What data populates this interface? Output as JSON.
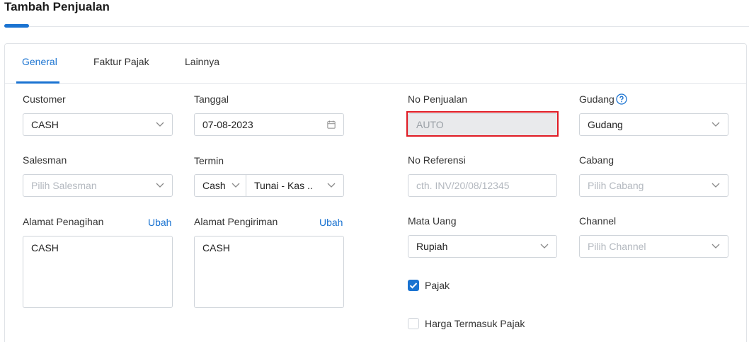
{
  "page": {
    "title": "Tambah Penjualan"
  },
  "tabs": [
    {
      "label": "General",
      "active": true
    },
    {
      "label": "Faktur Pajak",
      "active": false
    },
    {
      "label": "Lainnya",
      "active": false
    }
  ],
  "form": {
    "customer": {
      "label": "Customer",
      "value": "CASH"
    },
    "tanggal": {
      "label": "Tanggal",
      "value": "07-08-2023"
    },
    "no_penjualan": {
      "label": "No Penjualan",
      "value": "AUTO"
    },
    "gudang": {
      "label": "Gudang",
      "value": "Gudang"
    },
    "salesman": {
      "label": "Salesman",
      "placeholder": "Pilih Salesman"
    },
    "termin": {
      "label": "Termin",
      "type_value": "Cash",
      "account_value": "Tunai - Kas .."
    },
    "no_referensi": {
      "label": "No Referensi",
      "placeholder": "cth. INV/20/08/12345"
    },
    "cabang": {
      "label": "Cabang",
      "placeholder": "Pilih Cabang"
    },
    "alamat_penagihan": {
      "label": "Alamat Penagihan",
      "edit_label": "Ubah",
      "value": "CASH"
    },
    "alamat_pengiriman": {
      "label": "Alamat Pengiriman",
      "edit_label": "Ubah",
      "value": "CASH"
    },
    "mata_uang": {
      "label": "Mata Uang",
      "value": "Rupiah"
    },
    "channel": {
      "label": "Channel",
      "placeholder": "Pilih Channel"
    },
    "pajak": {
      "label": "Pajak",
      "checked": true
    },
    "harga_termasuk_pajak": {
      "label": "Harga Termasuk Pajak",
      "checked": false
    }
  },
  "colors": {
    "accent": "#1a73d1",
    "highlight": "#e01b24"
  },
  "icons": {
    "dropdown": "chevron-down-icon",
    "date": "calendar-icon",
    "help": "help-circle-icon",
    "check": "check-icon"
  }
}
